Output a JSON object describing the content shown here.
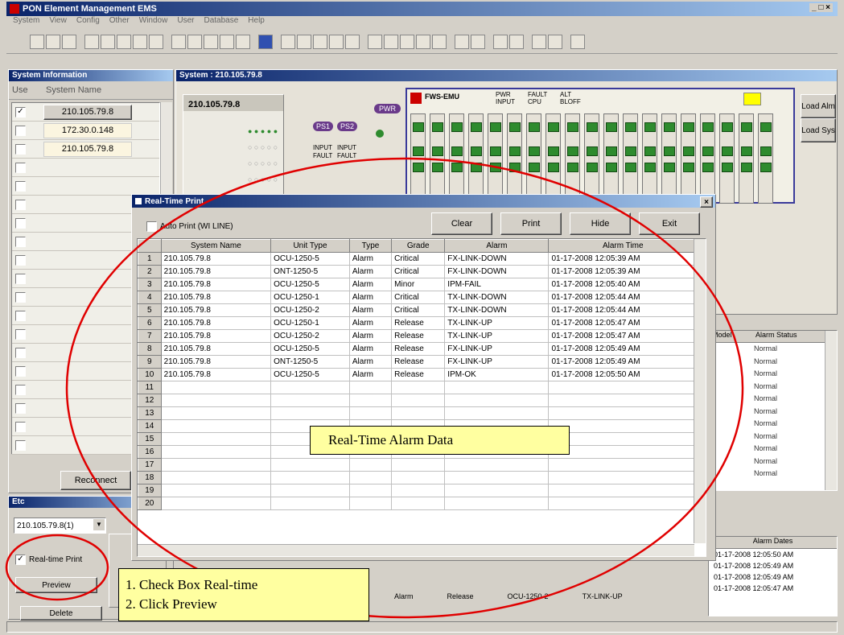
{
  "app": {
    "title": "PON Element Management EMS",
    "menu": [
      "System",
      "View",
      "Config",
      "Other",
      "Window",
      "User",
      "Database",
      "Help"
    ]
  },
  "left_panel": {
    "header": "System Information",
    "col_use": "Use",
    "col_system": "System Name",
    "systems": [
      {
        "name": "210.105.79.8",
        "checked": true
      },
      {
        "name": "172.30.0.148",
        "checked": false
      },
      {
        "name": "210.105.79.8",
        "checked": false
      }
    ],
    "reconnect_label": "Reconnect"
  },
  "bottom_left": {
    "header": "Etc",
    "combo_value": "210.105.79.8(1)",
    "realtime_print_label": "Real-time Print",
    "realtime_checked": true,
    "preview_label": "Preview",
    "delete_label": "Delete"
  },
  "system_view": {
    "header": "System : 210.105.79.8",
    "box_ip": "210.105.79.8",
    "pwr_label": "PWR",
    "ps1": "PS1",
    "ps2": "PS2",
    "input_label": "INPUT",
    "fault_label": "FAULT",
    "chassis_name": "FWS-EMU",
    "legend": [
      "PWR",
      "FAULT",
      "ALT",
      "INPUT",
      "CPU",
      "BLOFF"
    ],
    "load_alm": "Load Alm",
    "load_sys": "Load Sys"
  },
  "alarm_status_panel": {
    "col_model": "Model",
    "col_status": "Alarm Status",
    "statuses": [
      "Normal",
      "Normal",
      "Normal",
      "Normal",
      "Normal",
      "Normal",
      "Normal",
      "Normal",
      "Normal",
      "Normal",
      "Normal"
    ]
  },
  "alarm_dates_panel": {
    "col": "Alarm Dates",
    "dates": [
      "01-17-2008 12:05:50 AM",
      "01-17-2008 12:05:49 AM",
      "01-17-2008 12:05:49 AM",
      "01-17-2008 12:05:47 AM"
    ],
    "bottom_row": [
      "Alarm",
      "Release",
      "OCU-1250-2",
      "TX-LINK-UP"
    ]
  },
  "dialog": {
    "title": "Real-Time Print",
    "auto_print_label": "Auto Print (WI LINE)",
    "clear": "Clear",
    "print": "Print",
    "hide": "Hide",
    "exit": "Exit",
    "columns": [
      "System Name",
      "Unit Type",
      "Type",
      "Grade",
      "Alarm",
      "Alarm Time"
    ],
    "rows": [
      [
        "210.105.79.8",
        "OCU-1250-5",
        "Alarm",
        "Critical",
        "FX-LINK-DOWN",
        "01-17-2008 12:05:39 AM"
      ],
      [
        "210.105.79.8",
        "ONT-1250-5",
        "Alarm",
        "Critical",
        "FX-LINK-DOWN",
        "01-17-2008 12:05:39 AM"
      ],
      [
        "210.105.79.8",
        "OCU-1250-5",
        "Alarm",
        "Minor",
        "IPM-FAIL",
        "01-17-2008 12:05:40 AM"
      ],
      [
        "210.105.79.8",
        "OCU-1250-1",
        "Alarm",
        "Critical",
        "TX-LINK-DOWN",
        "01-17-2008 12:05:44 AM"
      ],
      [
        "210.105.79.8",
        "OCU-1250-2",
        "Alarm",
        "Critical",
        "TX-LINK-DOWN",
        "01-17-2008 12:05:44 AM"
      ],
      [
        "210.105.79.8",
        "OCU-1250-1",
        "Alarm",
        "Release",
        "TX-LINK-UP",
        "01-17-2008 12:05:47 AM"
      ],
      [
        "210.105.79.8",
        "OCU-1250-2",
        "Alarm",
        "Release",
        "TX-LINK-UP",
        "01-17-2008 12:05:47 AM"
      ],
      [
        "210.105.79.8",
        "OCU-1250-5",
        "Alarm",
        "Release",
        "FX-LINK-UP",
        "01-17-2008 12:05:49 AM"
      ],
      [
        "210.105.79.8",
        "ONT-1250-5",
        "Alarm",
        "Release",
        "FX-LINK-UP",
        "01-17-2008 12:05:49 AM"
      ],
      [
        "210.105.79.8",
        "OCU-1250-5",
        "Alarm",
        "Release",
        "IPM-OK",
        "01-17-2008 12:05:50 AM"
      ]
    ],
    "total_rows": 20
  },
  "annotations": {
    "alarm_data": "Real-Time Alarm Data",
    "step1": "1. Check Box Real-time",
    "step2": "2. Click Preview",
    "circle_color": "#e00000"
  }
}
